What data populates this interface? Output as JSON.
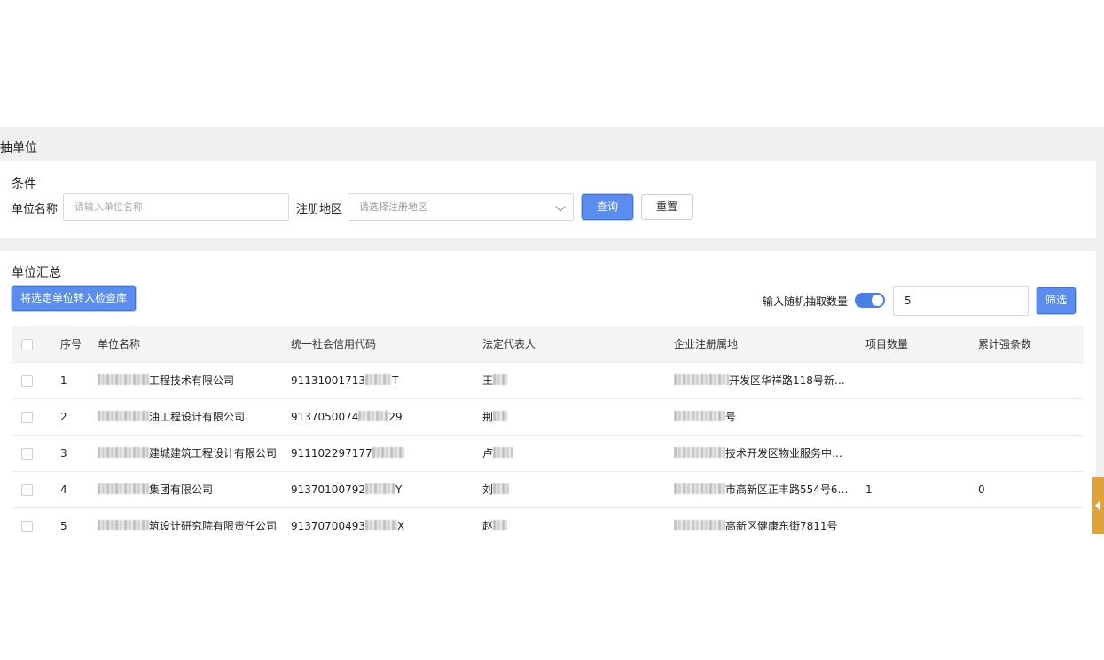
{
  "page": {
    "title": "抽单位"
  },
  "conditions": {
    "title": "条件",
    "name_label": "单位名称",
    "name_placeholder": "请输入单位名称",
    "region_label": "注册地区",
    "region_placeholder": "请选择注册地区",
    "query_label": "查询",
    "reset_label": "重置"
  },
  "summary": {
    "title": "单位汇总",
    "transfer_label": "将选定单位转入检查库",
    "random_label": "输入随机抽取数量",
    "random_enabled": true,
    "random_value": "5",
    "filter_label": "筛选"
  },
  "table": {
    "headers": [
      "序号",
      "单位名称",
      "统一社会信用代码",
      "法定代表人",
      "企业注册属地",
      "项目数量",
      "累计强条数"
    ],
    "rows": [
      {
        "idx": "1",
        "name": "工程技术有限公司",
        "code_a": "91131001713",
        "code_b": "T",
        "rep": "王",
        "addr": "开发区华祥路118号新…",
        "projects": "",
        "count": ""
      },
      {
        "idx": "2",
        "name": "油工程设计有限公司",
        "code_a": "9137050074",
        "code_b": "29",
        "rep": "荆",
        "addr": "号",
        "projects": "",
        "count": ""
      },
      {
        "idx": "3",
        "name": "建城建筑工程设计有限公司",
        "code_a": "911102297177",
        "code_b": "",
        "rep": "卢",
        "addr": "技术开发区物业服务中…",
        "projects": "",
        "count": ""
      },
      {
        "idx": "4",
        "name": "集团有限公司",
        "code_a": "91370100792",
        "code_b": "Y",
        "rep": "刘",
        "addr": "市高新区正丰路554号6…",
        "projects": "1",
        "count": "0"
      },
      {
        "idx": "5",
        "name": "筑设计研究院有限责任公司",
        "code_a": "91370700493",
        "code_b": "X",
        "rep": "赵",
        "addr": "高新区健康东街7811号",
        "projects": "",
        "count": ""
      }
    ]
  },
  "icons": {
    "select": "chevron-down-icon",
    "side_tab": "caret-left-icon"
  },
  "colors": {
    "primary": "#5b8def",
    "toggle": "#4a7fe6",
    "side_tab": "#e0a23a",
    "gray_bg": "#f0f0f0"
  }
}
